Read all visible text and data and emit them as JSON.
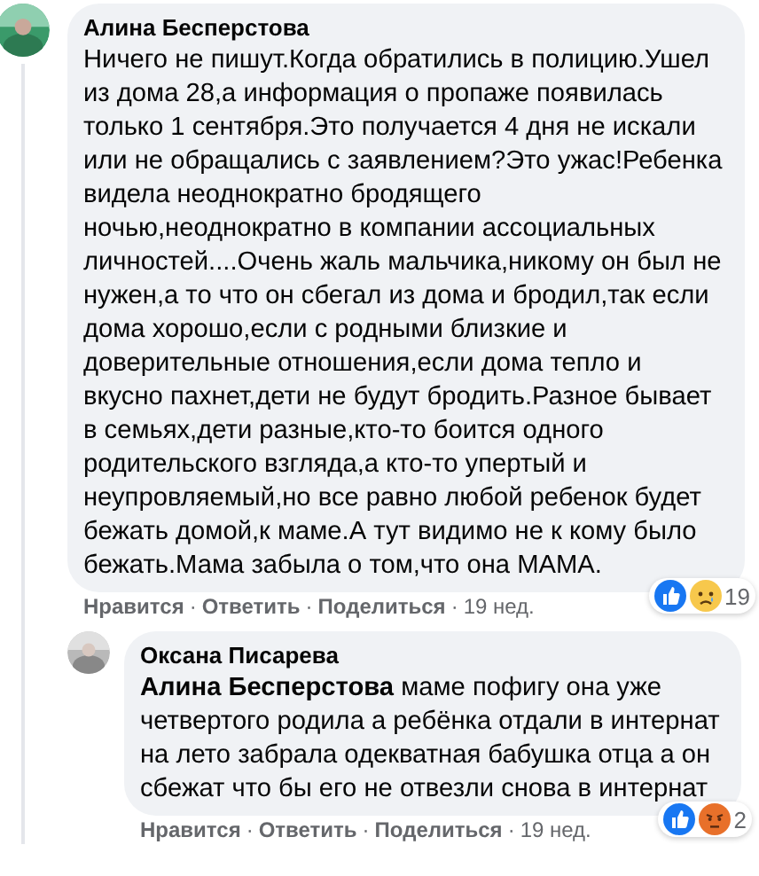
{
  "comments": [
    {
      "author": "Алина Бесперстова",
      "text": "Ничего не пишут.Когда обратились в полицию.Ушел из дома 28,а информация о пропаже появилась только 1 сентября.Это получается 4 дня не искали или не обращались с заявлением?Это ужас!Ребенка видела неоднократно бродящего ночью,неоднократно в компании ассоциальных личностей....Очень жаль мальчика,никому он был не нужен,а то что он сбегал из дома и бродил,так если дома хорошо,если с родными близкие и доверительные отношения,если дома тепло и вкусно пахнет,дети не будут бродить.Разное бывает в семьях,дети разные,кто-то боится одного родительского взгляда,а кто-то упертый и неупровляемый,но все равно любой ребенок будет бежать домой,к маме.А тут видимо не к кому было бежать.Мама забыла о том,что она МАМА.",
      "reactions": {
        "icons": [
          {
            "kind": "like"
          },
          {
            "kind": "sad"
          }
        ],
        "count": "19"
      },
      "actions": [
        "Нравится",
        "Ответить",
        "Поделиться"
      ],
      "separator": "·",
      "time": "19 нед.",
      "replies": [
        {
          "author": "Оксана Писарева",
          "text": "**Алина Бесперстова** маме пофигу она уже четвертого родила а ребёнка отдали в интернат на лето забрала одекватная бабушка отца а он сбежат что бы его не отвезли снова в интернат",
          "reactions": {
            "icons": [
              {
                "kind": "like"
              },
              {
                "kind": "angry"
              }
            ],
            "count": "2"
          },
          "actions": [
            "Нравится",
            "Ответить",
            "Поделиться"
          ],
          "separator": "·",
          "time": "19 нед."
        }
      ]
    }
  ]
}
